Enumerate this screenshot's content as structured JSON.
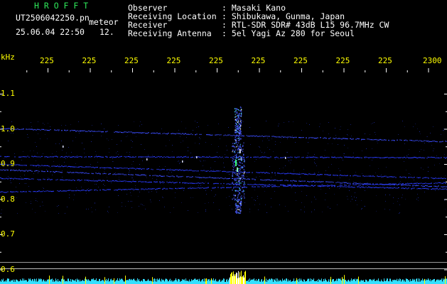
{
  "app": {
    "program_name": "H R O F F T",
    "file_name": "UT2506042250.pn",
    "mode_label": "meteor",
    "timestamp": "25.06.04 22:50",
    "count": "12."
  },
  "station": {
    "observer_label": "Observer",
    "observer_value": ": Masaki Kano",
    "location_label": "Receiving Location",
    "location_value": ": Shibukawa, Gunma, Japan",
    "receiver_label": "Receiver",
    "receiver_value": ": RTL-SDR SDR# 43dB L15 96.7MHz CW",
    "antenna_label": "Receiving Antenna",
    "antenna_value": ": 5el Yagi Az 280 for Seoul"
  },
  "axes": {
    "y_unit": "kHz",
    "y_ticks": [
      {
        "label": "1.1",
        "value": 1.1
      },
      {
        "label": "1.0",
        "value": 1.0
      },
      {
        "label": "0.9",
        "value": 0.9
      },
      {
        "label": "0.8",
        "value": 0.8
      },
      {
        "label": "0.7",
        "value": 0.7
      },
      {
        "label": "0.6",
        "value": 0.6
      }
    ],
    "x_ticks": [
      "225",
      "225",
      "225",
      "225",
      "225",
      "225",
      "225",
      "225",
      "225",
      "2300"
    ]
  },
  "colors": {
    "background": "#000000",
    "text": "#ffffff",
    "tick_labels": "#ffff00",
    "program_name": "#2ee85a",
    "signal": "#2a3cff",
    "spectrum": "#33e0ff"
  }
}
